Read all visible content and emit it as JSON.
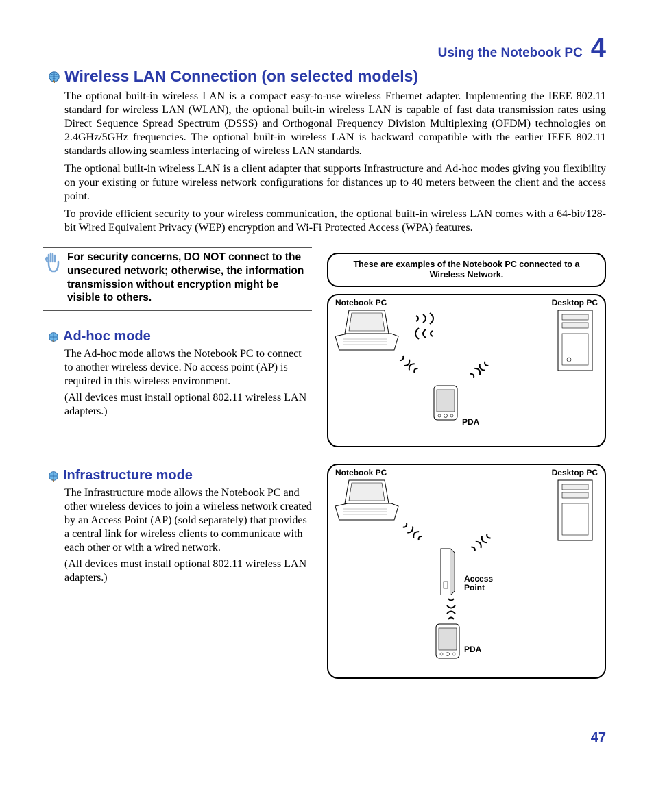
{
  "header": {
    "title": "Using the Notebook PC",
    "chapter_number": "4"
  },
  "main": {
    "title": "Wireless LAN Connection (on selected models)",
    "para1": "The optional built-in wireless LAN is a compact easy-to-use wireless Ethernet adapter. Implementing the IEEE 802.11 standard for wireless LAN (WLAN), the optional built-in wireless LAN is capable of fast data transmission rates using Direct Sequence Spread Spectrum (DSSS) and Orthogonal Frequency Division Multiplexing (OFDM) technologies on 2.4GHz/5GHz frequencies. The optional built-in wireless LAN is backward compatible with the earlier IEEE 802.11 standards allowing seamless interfacing of wireless LAN standards.",
    "para2": "The optional built-in wireless LAN is a client adapter that supports Infrastructure and Ad-hoc modes giving you flexibility on your existing or future wireless network configurations for distances up to 40 meters between the client and the access point.",
    "para3": "To provide efficient security to your wireless communication, the optional built-in wireless LAN comes with a 64-bit/128-bit Wired Equivalent Privacy (WEP) encryption and Wi-Fi Protected Access (WPA) features."
  },
  "warning": {
    "text": "For security concerns, DO NOT connect to the unsecured network; otherwise, the information transmission without encryption might be visible to others."
  },
  "adhoc": {
    "title": "Ad-hoc mode",
    "body": "The Ad-hoc mode allows the Notebook PC to connect to another wireless device. No access point (AP) is required in this wireless environment.",
    "note": "(All devices must install optional 802.11 wireless LAN adapters.)"
  },
  "infra": {
    "title": "Infrastructure mode",
    "body": "The Infrastructure mode allows the Notebook PC and other wireless devices to join a wireless network created by an Access Point (AP) (sold separately) that provides a central link for wireless clients to communicate with each other or with a wired network.",
    "note": "(All devices must install optional 802.11 wireless LAN adapters.)"
  },
  "diagrams": {
    "caption": "These are examples of the Notebook PC connected to a Wireless Network.",
    "labels": {
      "notebook": "Notebook PC",
      "desktop": "Desktop PC",
      "pda": "PDA",
      "ap_line1": "Access",
      "ap_line2": "Point"
    }
  },
  "page_number": "47"
}
